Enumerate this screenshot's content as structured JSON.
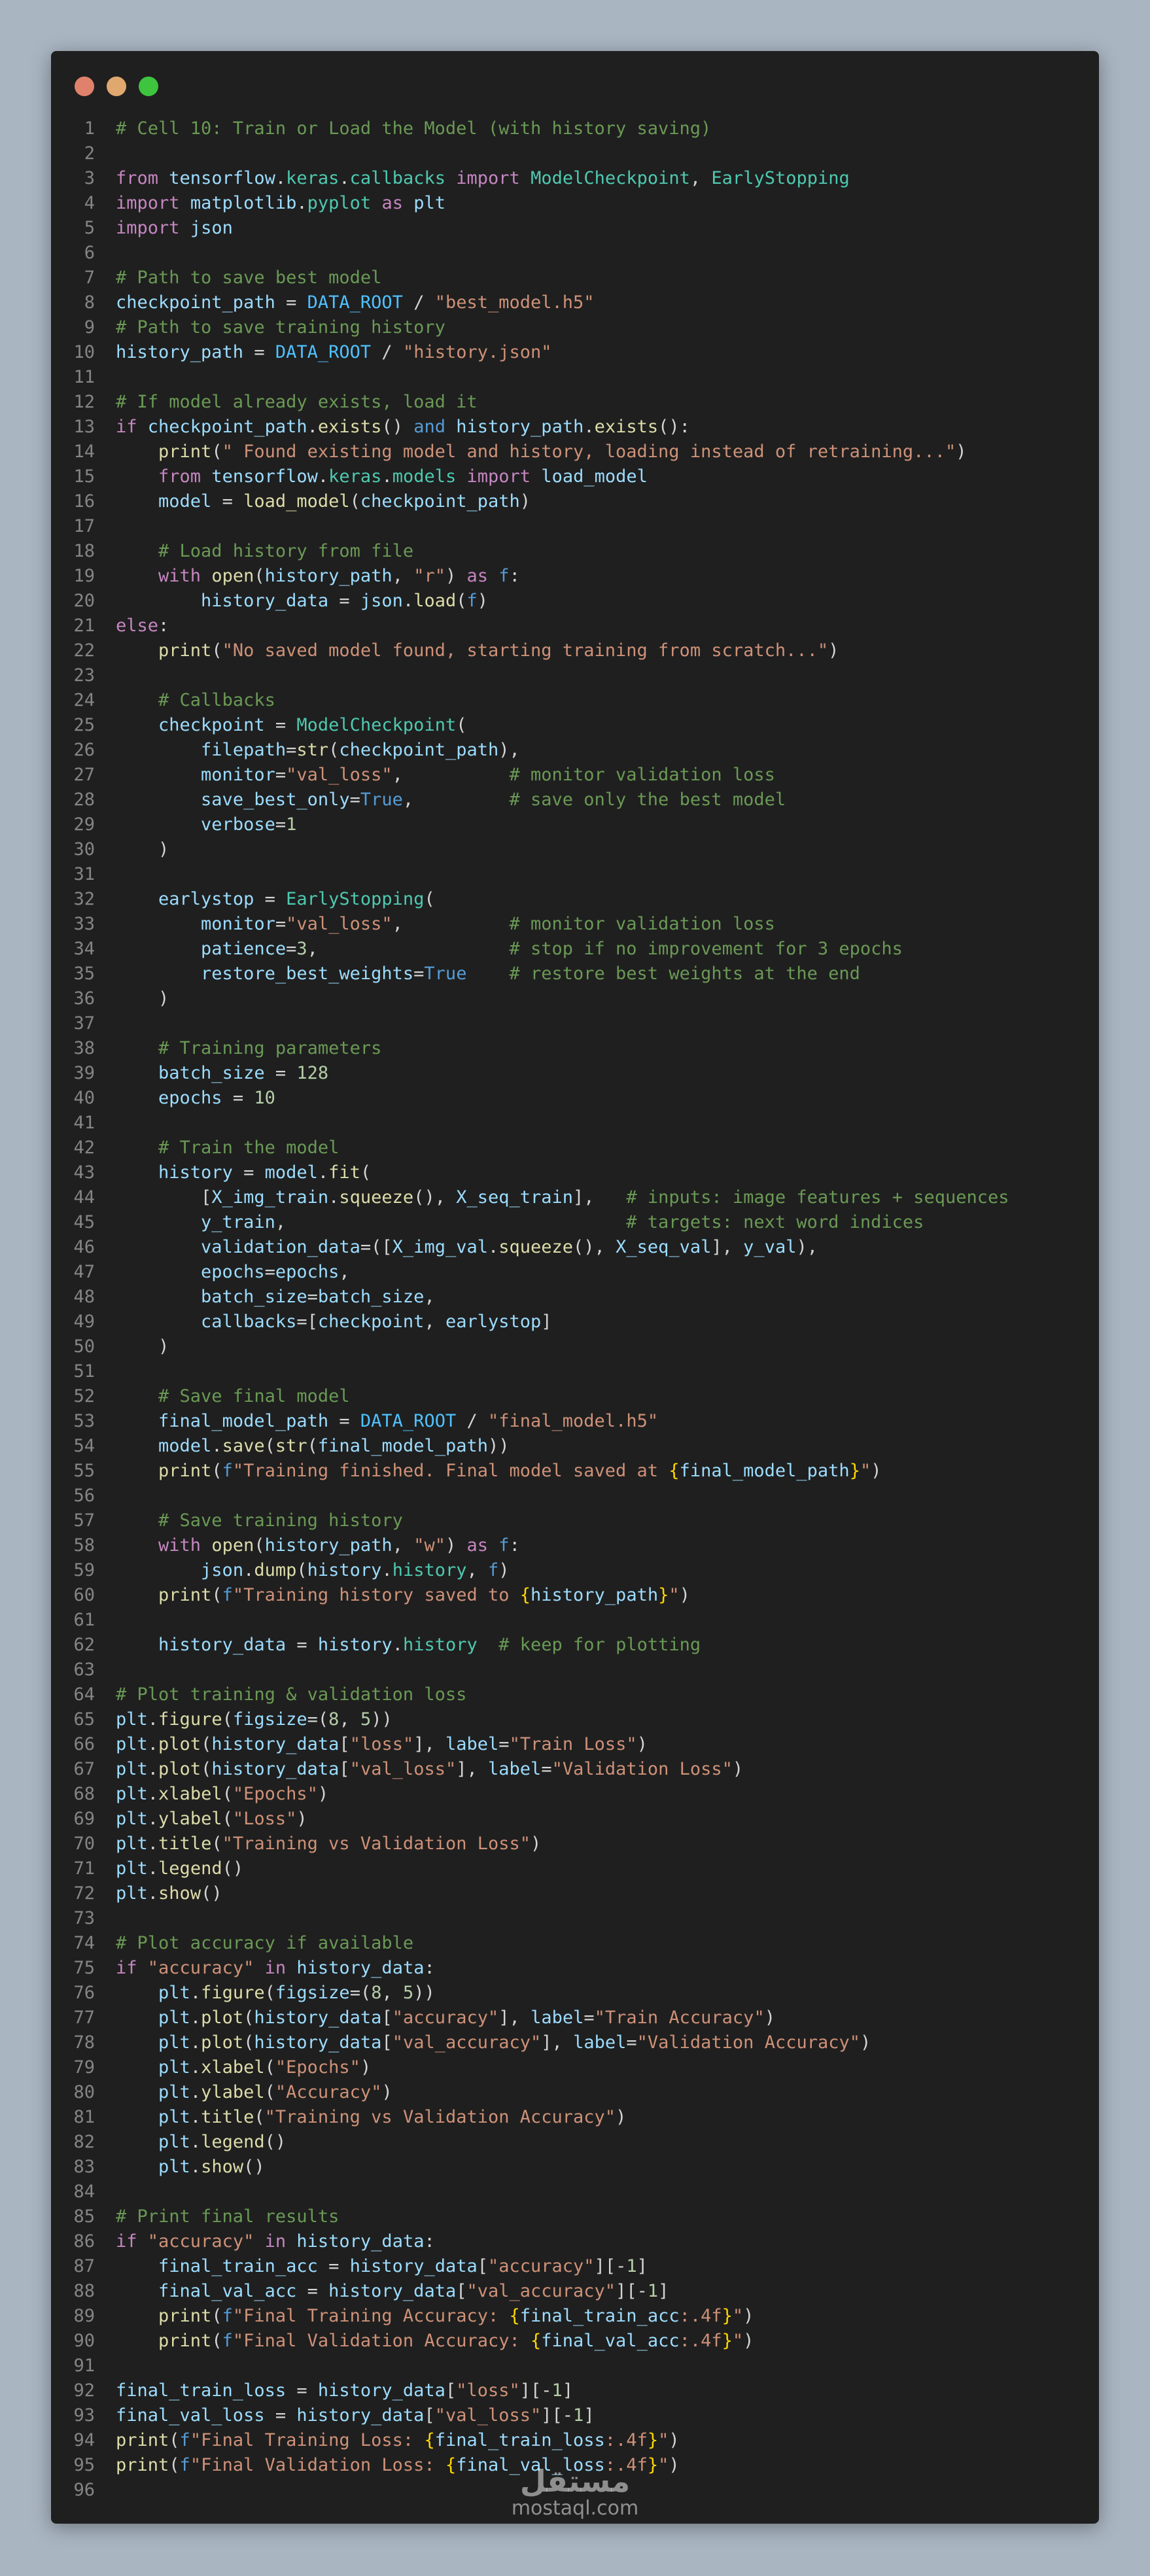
{
  "window": {
    "controls": [
      {
        "name": "close",
        "color": "#e0826b"
      },
      {
        "name": "minimize",
        "color": "#e0a86e"
      },
      {
        "name": "maximize",
        "color": "#3ec43e"
      }
    ]
  },
  "code": {
    "language": "python",
    "lines": [
      "# Cell 10: Train or Load the Model (with history saving)",
      "",
      "from tensorflow.keras.callbacks import ModelCheckpoint, EarlyStopping",
      "import matplotlib.pyplot as plt",
      "import json",
      "",
      "# Path to save best model",
      "checkpoint_path = DATA_ROOT / \"best_model.h5\"",
      "# Path to save training history",
      "history_path = DATA_ROOT / \"history.json\"",
      "",
      "# If model already exists, load it",
      "if checkpoint_path.exists() and history_path.exists():",
      "    print(\" Found existing model and history, loading instead of retraining...\")",
      "    from tensorflow.keras.models import load_model",
      "    model = load_model(checkpoint_path)",
      "",
      "    # Load history from file",
      "    with open(history_path, \"r\") as f:",
      "        history_data = json.load(f)",
      "else:",
      "    print(\"No saved model found, starting training from scratch...\")",
      "",
      "    # Callbacks",
      "    checkpoint = ModelCheckpoint(",
      "        filepath=str(checkpoint_path),",
      "        monitor=\"val_loss\",          # monitor validation loss",
      "        save_best_only=True,         # save only the best model",
      "        verbose=1",
      "    )",
      "",
      "    earlystop = EarlyStopping(",
      "        monitor=\"val_loss\",          # monitor validation loss",
      "        patience=3,                  # stop if no improvement for 3 epochs",
      "        restore_best_weights=True    # restore best weights at the end",
      "    )",
      "",
      "    # Training parameters",
      "    batch_size = 128",
      "    epochs = 10",
      "",
      "    # Train the model",
      "    history = model.fit(",
      "        [X_img_train.squeeze(), X_seq_train],   # inputs: image features + sequences",
      "        y_train,                                # targets: next word indices",
      "        validation_data=([X_img_val.squeeze(), X_seq_val], y_val),",
      "        epochs=epochs,",
      "        batch_size=batch_size,",
      "        callbacks=[checkpoint, earlystop]",
      "    )",
      "",
      "    # Save final model",
      "    final_model_path = DATA_ROOT / \"final_model.h5\"",
      "    model.save(str(final_model_path))",
      "    print(f\"Training finished. Final model saved at {final_model_path}\")",
      "",
      "    # Save training history",
      "    with open(history_path, \"w\") as f:",
      "        json.dump(history.history, f)",
      "    print(f\"Training history saved to {history_path}\")",
      "",
      "    history_data = history.history  # keep for plotting",
      "",
      "# Plot training & validation loss",
      "plt.figure(figsize=(8, 5))",
      "plt.plot(history_data[\"loss\"], label=\"Train Loss\")",
      "plt.plot(history_data[\"val_loss\"], label=\"Validation Loss\")",
      "plt.xlabel(\"Epochs\")",
      "plt.ylabel(\"Loss\")",
      "plt.title(\"Training vs Validation Loss\")",
      "plt.legend()",
      "plt.show()",
      "",
      "# Plot accuracy if available",
      "if \"accuracy\" in history_data:",
      "    plt.figure(figsize=(8, 5))",
      "    plt.plot(history_data[\"accuracy\"], label=\"Train Accuracy\")",
      "    plt.plot(history_data[\"val_accuracy\"], label=\"Validation Accuracy\")",
      "    plt.xlabel(\"Epochs\")",
      "    plt.ylabel(\"Accuracy\")",
      "    plt.title(\"Training vs Validation Accuracy\")",
      "    plt.legend()",
      "    plt.show()",
      "",
      "# Print final results",
      "if \"accuracy\" in history_data:",
      "    final_train_acc = history_data[\"accuracy\"][-1]",
      "    final_val_acc = history_data[\"val_accuracy\"][-1]",
      "    print(f\"Final Training Accuracy: {final_train_acc:.4f}\")",
      "    print(f\"Final Validation Accuracy: {final_val_acc:.4f}\")",
      "",
      "final_train_loss = history_data[\"loss\"][-1]",
      "final_val_loss = history_data[\"val_loss\"][-1]",
      "print(f\"Final Training Loss: {final_train_loss:.4f}\")",
      "print(f\"Final Validation Loss: {final_val_loss:.4f}\")",
      ""
    ]
  },
  "watermark": {
    "arabic": "مستقل",
    "latin": "mostaql.com"
  }
}
